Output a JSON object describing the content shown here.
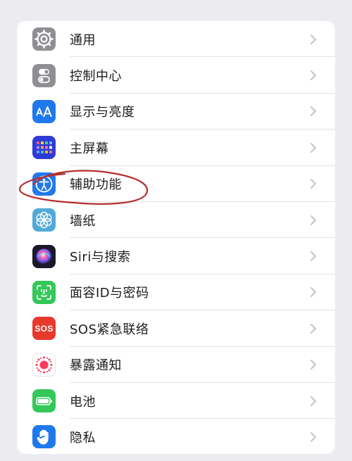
{
  "settings": {
    "items": [
      {
        "label": "通用",
        "icon": "gear-icon",
        "color": "#8e8e93"
      },
      {
        "label": "控制中心",
        "icon": "toggles-icon",
        "color": "#8e8e93"
      },
      {
        "label": "显示与亮度",
        "icon": "text-size-icon",
        "color": "#1f79ec"
      },
      {
        "label": "主屏幕",
        "icon": "app-grid-icon",
        "color": "#2e3bd6"
      },
      {
        "label": "辅助功能",
        "icon": "accessibility-icon",
        "color": "#1f79ec"
      },
      {
        "label": "墙纸",
        "icon": "flower-icon",
        "color": "#52a9d8"
      },
      {
        "label": "Siri与搜索",
        "icon": "siri-orb-icon",
        "color": "#1a1a2a"
      },
      {
        "label": "面容ID与密码",
        "icon": "face-id-icon",
        "color": "#34c759"
      },
      {
        "label": "SOS紧急联络",
        "icon": "sos-icon",
        "color": "#e8392d",
        "icon_text": "SOS"
      },
      {
        "label": "暴露通知",
        "icon": "exposure-dots-icon",
        "color": "#ffffff"
      },
      {
        "label": "电池",
        "icon": "battery-icon",
        "color": "#34c759"
      },
      {
        "label": "隐私",
        "icon": "hand-icon",
        "color": "#1f79ec"
      }
    ]
  },
  "annotation": {
    "color": "#b42f2c",
    "target": "辅助功能"
  }
}
